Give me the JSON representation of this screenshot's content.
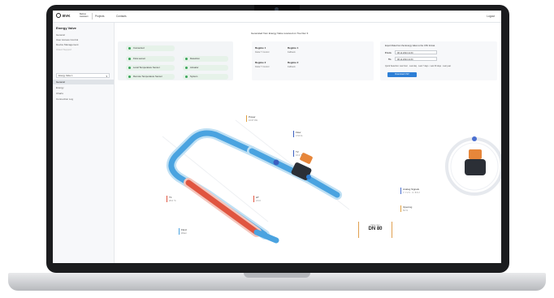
{
  "topbar": {
    "logo_text": "BVK",
    "brand_sub": "Belimo Assistant",
    "nav_projects": "Projects",
    "nav_contacts": "Contacts",
    "logout": "Logout"
  },
  "sidebar": {
    "title": "Energy Valve",
    "items": [
      "General",
      "User Access Control",
      "Device Management",
      "Cloud Support"
    ],
    "select_value": "Energy Valve 1",
    "sub_items": [
      "General",
      "Energy",
      "Charts",
      "Connection Log"
    ]
  },
  "status": {
    "pills": [
      "Connected",
      "Flow sensor",
      "Local Temperature Sensor",
      "Remote Temperature Sensor",
      "Detection",
      "Actuator",
      "System"
    ],
    "color_ok": "#3aa55a"
  },
  "regimes": {
    "title": "Generated from Energy Valve received on Tue Dec 3",
    "r1": "Regime 1",
    "r1_val": "Delta T Control",
    "r1b": "Regime 1",
    "r1b_val": "Fallback",
    "r2": "Regime 2",
    "r2_val": "Delta T Control",
    "r2b": "Regime 2",
    "r2b_val": "Fallback"
  },
  "export": {
    "title": "Export Data from the Energy Valve to the CSV format",
    "from_label": "From",
    "from_value": "08.12.2024 12:30",
    "to_label": "To",
    "to_value": "08.12.2024 12:30",
    "quick": "Quick Selection: Last hour · Last day · Last 7 days · Last 30 days · Last year",
    "button": "Download CSV",
    "accent": "#2d7fd6"
  },
  "diagram": {
    "power_label": "Power",
    "power_value": "10.07 kW",
    "flow_label": "Flow",
    "flow_value": "2.64 l/s",
    "t2_label": "T2",
    "t2_value": "16.4 °C",
    "t1_label": "T1",
    "t1_value": "20.0 °C",
    "dt_label": "ΔT",
    "dt_value": "3.6 K",
    "fluid_label": "Fluid",
    "fluid_value": "Water",
    "analog_label": "Analog Signals",
    "analog_value": "Y: 7.2 V · U: 8.6 V",
    "opening_label": "Opening",
    "opening_value": "81 %",
    "dn_label": "Valve size",
    "dn_value": "DN 80",
    "color_hot": "#e05540",
    "color_cold": "#4aa3e0",
    "color_power": "#e0a040",
    "color_flow": "#3b5fc0",
    "color_accent_dial": "#4a6fd0"
  }
}
